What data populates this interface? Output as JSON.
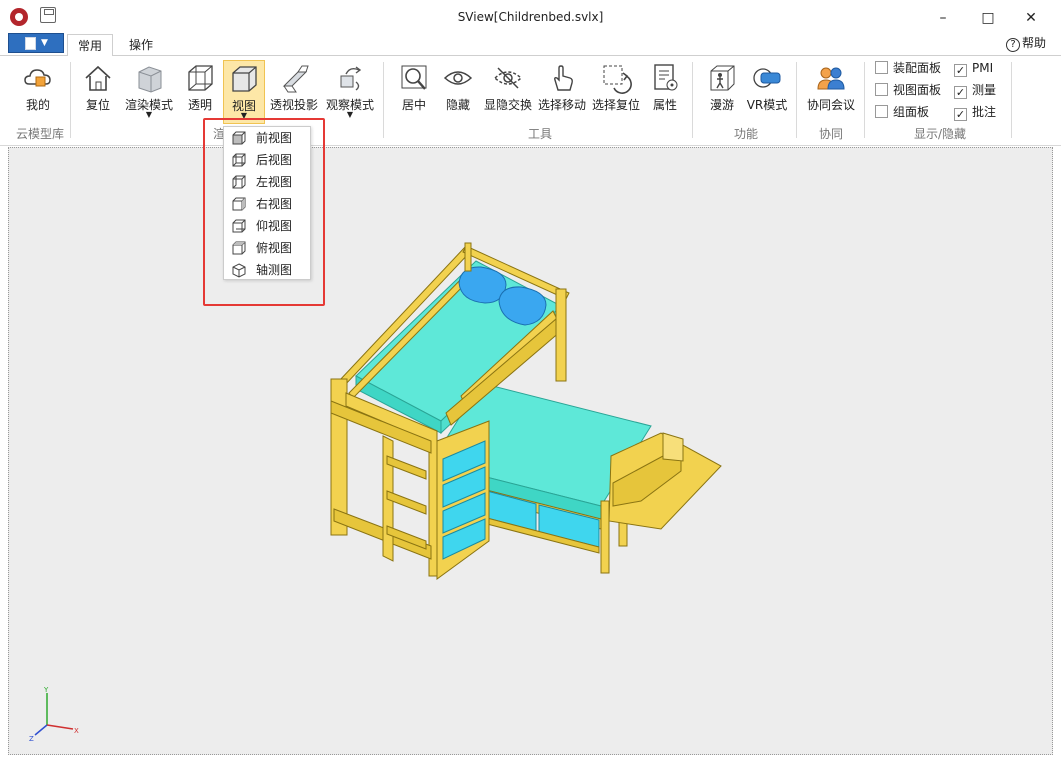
{
  "window": {
    "title": "SView[Childrenbed.svlx]",
    "minimize": "–",
    "maximize": "□",
    "close": "✕"
  },
  "tabs": [
    {
      "label": "常用"
    },
    {
      "label": "操作"
    }
  ],
  "help": {
    "icon": "?",
    "label": "帮助"
  },
  "ribbon": {
    "buttons": {
      "mine": "我的",
      "reset": "复位",
      "render_mode": "渲染模式",
      "transparent": "透明",
      "view": "视图",
      "perspective": "透视投影",
      "observe_mode": "观察模式",
      "center": "居中",
      "hide": "隐藏",
      "show_hide_swap": "显隐交换",
      "select_move": "选择移动",
      "select_reset": "选择复位",
      "properties": "属性",
      "roam": "漫游",
      "vr_mode": "VR模式",
      "collab_meeting": "协同会议"
    },
    "groups": {
      "cloud_library": "云模型库",
      "render_partial": "渲染",
      "tools": "工具",
      "function": "功能",
      "collab": "协同",
      "show_hide": "显示/隐藏"
    },
    "checkboxes": [
      {
        "label": "装配面板",
        "checked": ""
      },
      {
        "label": "视图面板",
        "checked": ""
      },
      {
        "label": "组面板",
        "checked": ""
      },
      {
        "label": "PMI",
        "checked": "✓"
      },
      {
        "label": "测量",
        "checked": "✓"
      },
      {
        "label": "批注",
        "checked": "✓"
      }
    ]
  },
  "view_menu": {
    "items": [
      {
        "label": "前视图",
        "icon": "front-view-icon"
      },
      {
        "label": "后视图",
        "icon": "back-view-icon"
      },
      {
        "label": "左视图",
        "icon": "left-view-icon"
      },
      {
        "label": "右视图",
        "icon": "right-view-icon"
      },
      {
        "label": "仰视图",
        "icon": "bottom-view-icon"
      },
      {
        "label": "俯视图",
        "icon": "top-view-icon"
      },
      {
        "label": "轴测图",
        "icon": "isometric-view-icon"
      }
    ]
  },
  "axis": {
    "y": "Y",
    "x": "X",
    "z": "Z"
  },
  "colors": {
    "frame": "#f2d24f",
    "mattress": "#5ee8d8",
    "drawer": "#3fd6ee",
    "pillow": "#3aa7f0",
    "highlight": "#e53935"
  }
}
